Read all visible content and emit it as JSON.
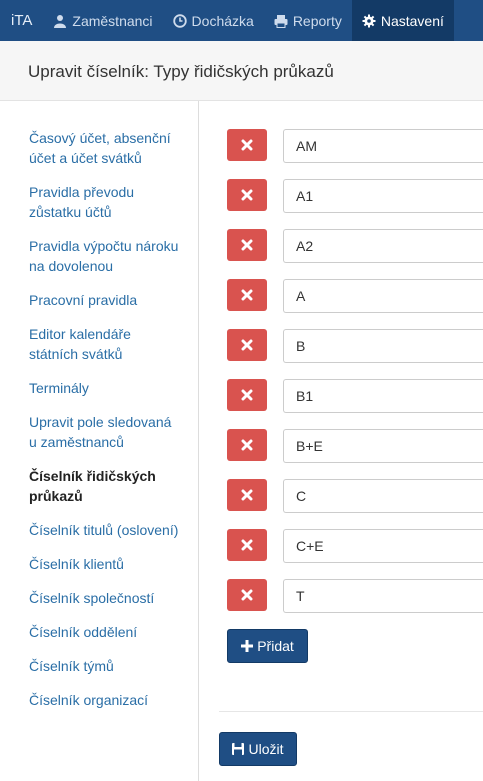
{
  "navbar": {
    "brand": "iTA",
    "items": [
      {
        "label": "Zaměstnanci",
        "icon": "user-icon"
      },
      {
        "label": "Docházka",
        "icon": "clock-icon"
      },
      {
        "label": "Reporty",
        "icon": "print-icon"
      },
      {
        "label": "Nastavení",
        "icon": "gear-icon",
        "active": true
      }
    ]
  },
  "header": {
    "title": "Upravit číselník: Typy řidičských průkazů"
  },
  "sidebar": {
    "items": [
      {
        "label": "Časový účet, absenční účet a účet svátků"
      },
      {
        "label": "Pravidla převodu zůstatku účtů"
      },
      {
        "label": "Pravidla výpočtu nároku na dovolenou"
      },
      {
        "label": "Pracovní pravidla"
      },
      {
        "label": "Editor kalendáře státních svátků"
      },
      {
        "label": "Terminály"
      },
      {
        "label": "Upravit pole sledovaná u zaměstnanců"
      },
      {
        "label": "Číselník řidičských průkazů",
        "active": true
      },
      {
        "label": "Číselník titulů (oslovení)"
      },
      {
        "label": "Číselník klientů"
      },
      {
        "label": "Číselník společností"
      },
      {
        "label": "Číselník oddělení"
      },
      {
        "label": "Číselník týmů"
      },
      {
        "label": "Číselník organizací"
      }
    ]
  },
  "license_types": {
    "values": [
      "AM",
      "A1",
      "A2",
      "A",
      "B",
      "B1",
      "B+E",
      "C",
      "C+E",
      "T"
    ]
  },
  "actions": {
    "add_label": "Přidat",
    "save_label": "Uložit"
  },
  "colors": {
    "navbar": "#1f4e84",
    "delete": "#d9534f",
    "link": "#2a6ea6"
  }
}
